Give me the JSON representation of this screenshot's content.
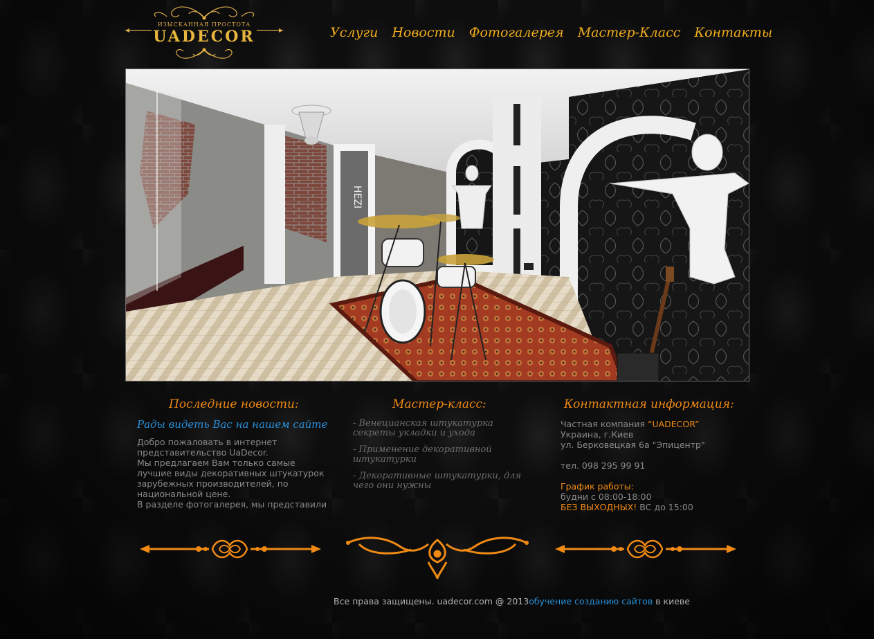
{
  "logo": {
    "tagline": "ИЗЫСКАННАЯ ПРОСТОТА",
    "name": "UADECOR"
  },
  "nav": {
    "items": [
      "Услуги",
      "Новости",
      "Фотогалерея",
      "Мастер-Класс",
      "Контакты"
    ]
  },
  "hero": {
    "description": "interior-render-music-room",
    "door_text": "HEZI"
  },
  "news": {
    "heading": "Последние новости:",
    "link": "Рады видеть Вас на нашем сайте",
    "lines": [
      "Добро пожаловать в интернет",
      "представительство UaDecor.",
      "Мы предлагаем Вам только самые",
      "лучшие виды декоративных штукатурок",
      "зарубежных производителей, по",
      "национальной цене.",
      "В разделе фотогалерея, мы представили"
    ]
  },
  "masterclass": {
    "heading": "Мастер-класс:",
    "items": [
      "- Венецианская штукатурка секреты укладки и ухода",
      "- Применение декоративной штукатурки",
      "- Декоративные штукатурки, для чего они нужны"
    ]
  },
  "contacts": {
    "heading": "Контактная информация:",
    "company_prefix": "Частная компания ",
    "company_name": "“UADECOR”",
    "country_city": "Украина, г.Киев",
    "address": "ул. Берковецкая 6а \"Эпицентр\"",
    "phone": "тел. 098 295 99 91",
    "schedule_label": "График работы:",
    "weekdays": "будни с 08:00-18:00",
    "no_days_off": "БЕЗ ВЫХОДНЫХ!",
    "sunday": " ВС до 15:00"
  },
  "footer": {
    "copyright": "Все права защищены. uadecor.com @  2013",
    "link": "обучение созданию сайтов",
    "suffix": " в киеве"
  },
  "colors": {
    "accent": "#f08a14",
    "gold": "#e8b53d",
    "link": "#2a8fd8",
    "text": "#8a8a8a"
  }
}
